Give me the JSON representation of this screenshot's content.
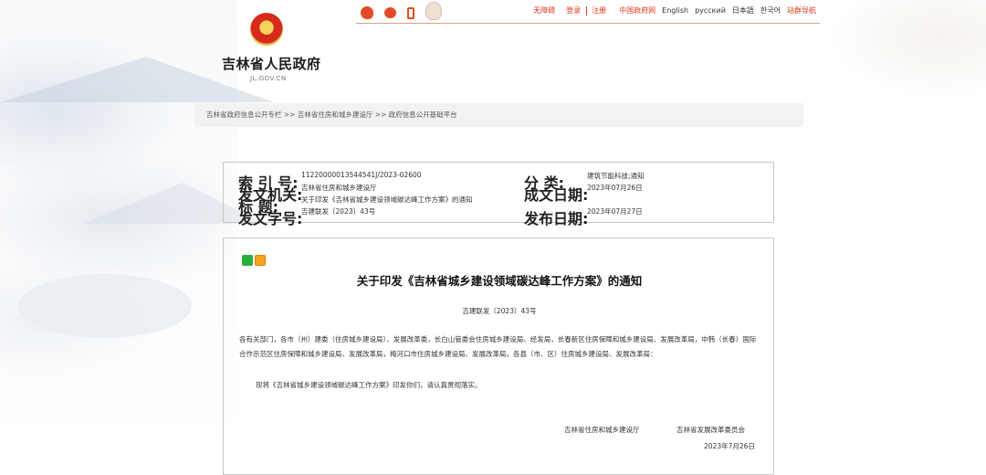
{
  "topbar": {
    "accessibility": "无障碍",
    "login": "登录",
    "register": "注册",
    "china_gov": "中国政府网",
    "languages": [
      "English",
      "русский",
      "日本語",
      "한국어"
    ],
    "cross_border": "站群导航"
  },
  "site": {
    "title": "吉林省人民政府",
    "domain": "JL.GOV.CN"
  },
  "breadcrumb": "吉林省政府信息公开专栏 >> 吉林省住房和城乡建设厅 >> 政府信息公开基础平台",
  "meta": {
    "index_label": "索  引 号:",
    "index_value": "11220000013544541J/2023-02600",
    "category_label": "分    类:",
    "category_value": "建筑节能科技;通知",
    "issuer_label": "发文机关:",
    "issuer_value": "吉林省住房和城乡建设厅",
    "created_label": "成文日期:",
    "created_value": "2023年07月26日",
    "title_label": "标    题:",
    "title_value": "关于印发《吉林省城乡建设领域碳达峰工作方案》的通知",
    "docno_label": "发文字号:",
    "docno_value": "吉建联发〔2023〕43号",
    "published_label": "发布日期:",
    "published_value": "2023年07月27日"
  },
  "article": {
    "title": "关于印发《吉林省城乡建设领域碳达峰工作方案》的通知",
    "doc_number": "吉建联发〔2023〕43号",
    "body1": "各有关部门，各市（州）建委（住房城乡建设局）、发展改革委，长白山管委会住房城乡建设局、经发局，长春新区住房保障和城乡建设局、发展改革局，中韩（长春）国际合作示范区住房保障和城乡建设局、发展改革局，梅河口市住房城乡建设局、发展改革局，各县（市、区）住房城乡建设局、发展改革局：",
    "body2": "现将《吉林省城乡建设领域碳达峰工作方案》印发你们，请认真贯彻落实。",
    "signer1": "吉林省住房和城乡建设厅",
    "signer2": "吉林省发展改革委员会",
    "sign_date": "2023年7月26日"
  },
  "icons": {
    "topbar": [
      "wechat-icon",
      "weibo-icon",
      "mobile-icon",
      "mascot-icon"
    ],
    "share": [
      "wechat-share-icon",
      "weibo-share-icon"
    ]
  },
  "colors": {
    "accent": "#e03a1e",
    "border": "#c8c8c8",
    "breadcrumb_bg": "#f2f2f2"
  }
}
